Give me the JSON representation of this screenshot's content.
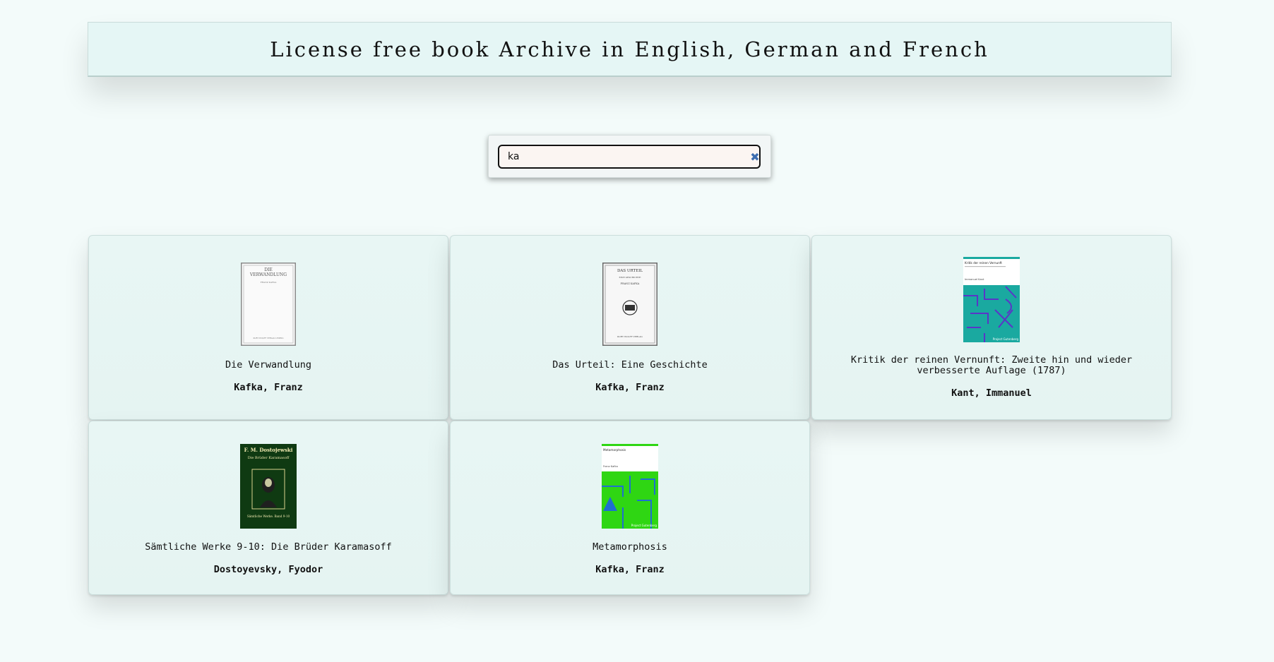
{
  "header": {
    "title": "License free book Archive in English, German and French"
  },
  "search": {
    "value": "ka",
    "placeholder": "",
    "clear_label": "✖"
  },
  "books": [
    {
      "title": "Die Verwandlung",
      "author": "Kafka, Franz",
      "cover": {
        "line1": "DIE",
        "line2": "VERWANDLUNG",
        "line3": "FRANZ KAFKA",
        "foot": "KURT WOLFF VERLAG LEIPZIG"
      }
    },
    {
      "title": "Das Urteil: Eine Geschichte",
      "author": "Kafka, Franz",
      "cover": {
        "line1": "DAS URTEIL",
        "line2": "EINE GESCHICHTE",
        "line3": "FRANZ KAFKA",
        "foot": "KURT WOLFF VERLAG"
      }
    },
    {
      "title": "Kritik der reinen Vernunft: Zweite hin und wieder verbesserte Auflage (1787)",
      "author": "Kant, Immanuel",
      "cover": {
        "line1": "Kritik der reinen Vernunft",
        "line2": "Immanuel Kant",
        "brand": "Project Gutenberg",
        "color": "#1aa9a0"
      }
    },
    {
      "title": "Sämtliche Werke 9-10: Die Brüder Karamasoff",
      "author": "Dostoyevsky, Fyodor",
      "cover": {
        "line1": "F. M. Dostojewski",
        "line2": "Die Brüder Karamasoff",
        "line3": "Sämtliche Werke. Band 9-10",
        "color": "#0f3a12"
      }
    },
    {
      "title": "Metamorphosis",
      "author": "Kafka, Franz",
      "cover": {
        "line1": "Metamorphosis",
        "line2": "Franz Kafka",
        "brand": "Project Gutenberg",
        "color": "#2fd613"
      }
    }
  ]
}
